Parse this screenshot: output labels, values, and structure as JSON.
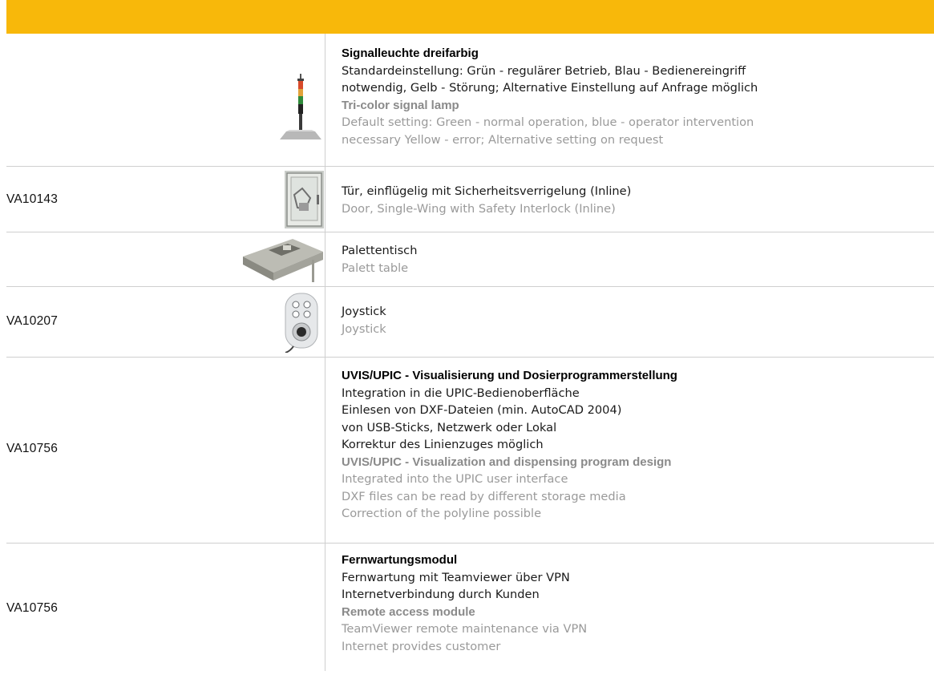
{
  "colors": {
    "header_bar": "#f8b80a",
    "german_text": "#1a1a1a",
    "english_text": "#9a9a9a",
    "divider": "#cfcfcf"
  },
  "rows": [
    {
      "code": "",
      "image": "signal-lamp",
      "title_de": "Signalleuchte dreifarbig",
      "lines_de": [
        "Standardeinstellung: Grün - regulärer Betrieb, Blau - Bedienereingriff",
        "notwendig, Gelb - Störung; Alternative Einstellung auf Anfrage möglich"
      ],
      "title_en": "Tri-color signal lamp",
      "lines_en": [
        "Default setting: Green - normal operation, blue - operator intervention",
        "necessary Yellow - error; Alternative setting on request"
      ]
    },
    {
      "code": "VA10143",
      "image": "door-cabinet",
      "lines_de": [
        "Tür, einflügelig mit Sicherheitsverrigelung (Inline)"
      ],
      "lines_en": [
        "Door, Single-Wing with Safety Interlock (Inline)"
      ]
    },
    {
      "code": "",
      "image": "pallet-table",
      "lines_de": [
        "Palettentisch"
      ],
      "lines_en": [
        "Palett table"
      ]
    },
    {
      "code": "VA10207",
      "image": "joystick",
      "lines_de": [
        "Joystick"
      ],
      "lines_en": [
        "Joystick"
      ]
    },
    {
      "code": "VA10756",
      "image": "",
      "title_de": "UVIS/UPIC - Visualisierung und Dosierprogrammerstellung",
      "lines_de": [
        "Integration in die UPIC-Bedienoberfläche",
        "Einlesen von DXF-Dateien (min. AutoCAD 2004)",
        "von USB-Sticks, Netzwerk oder Lokal",
        "Korrektur des Linienzuges möglich"
      ],
      "title_en": "UVIS/UPIC - Visualization and dispensing program design",
      "lines_en": [
        "Integrated into the UPIC user interface",
        "DXF files can be read by different storage media",
        "Correction of the polyline possible"
      ]
    },
    {
      "code": "VA10756",
      "image": "",
      "title_de": "Fernwartungsmodul",
      "lines_de": [
        "Fernwartung mit Teamviewer über VPN",
        "Internetverbindung durch Kunden"
      ],
      "title_en": "Remote access module",
      "lines_en": [
        "TeamViewer remote maintenance via VPN",
        "Internet provides customer"
      ]
    }
  ]
}
